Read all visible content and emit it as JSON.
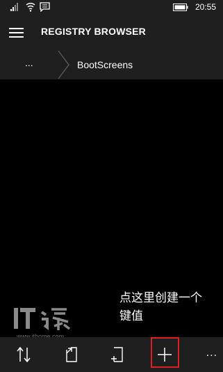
{
  "status_bar": {
    "time": "20:55",
    "icons": [
      "signal-icon",
      "wifi-icon",
      "message-icon",
      "battery-icon"
    ]
  },
  "header": {
    "menu_icon": "hamburger-icon",
    "title": "REGISTRY BROWSER"
  },
  "breadcrumb": {
    "parent": "...",
    "current": "BootScreens"
  },
  "annotation": {
    "line1": "点这里创建一个",
    "line2": "键值"
  },
  "watermark": {
    "url": "www.ithome.com"
  },
  "app_bar": {
    "buttons": [
      "sort-icon",
      "export-icon",
      "rename-icon",
      "add-icon"
    ],
    "more": "..."
  },
  "colors": {
    "chrome": "#1f1f1f",
    "background": "#000000",
    "highlight": "#e02020"
  }
}
